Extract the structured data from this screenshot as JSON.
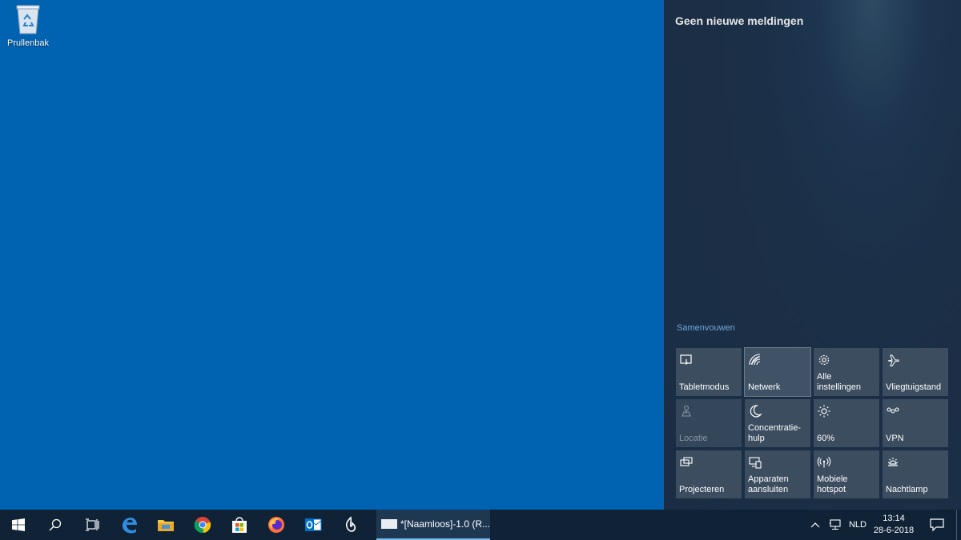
{
  "desktop": {
    "recycle_bin_label": "Prullenbak"
  },
  "action_center": {
    "title": "Geen nieuwe meldingen",
    "collapse_label": "Samenvouwen",
    "tiles": [
      {
        "label": "Tabletmodus"
      },
      {
        "label": "Netwerk"
      },
      {
        "label": "Alle instellingen"
      },
      {
        "label": "Vliegtuigstand"
      },
      {
        "label": "Locatie"
      },
      {
        "label": "Concentratie-hulp"
      },
      {
        "label": "60%"
      },
      {
        "label": "VPN"
      },
      {
        "label": "Projecteren"
      },
      {
        "label": "Apparaten aansluiten"
      },
      {
        "label": "Mobiele hotspot"
      },
      {
        "label": "Nachtlamp"
      }
    ]
  },
  "taskbar": {
    "running_app_title": "*[Naamloos]-1.0 (R...",
    "language": "NLD",
    "time": "13:14",
    "date": "28-6-2018"
  }
}
